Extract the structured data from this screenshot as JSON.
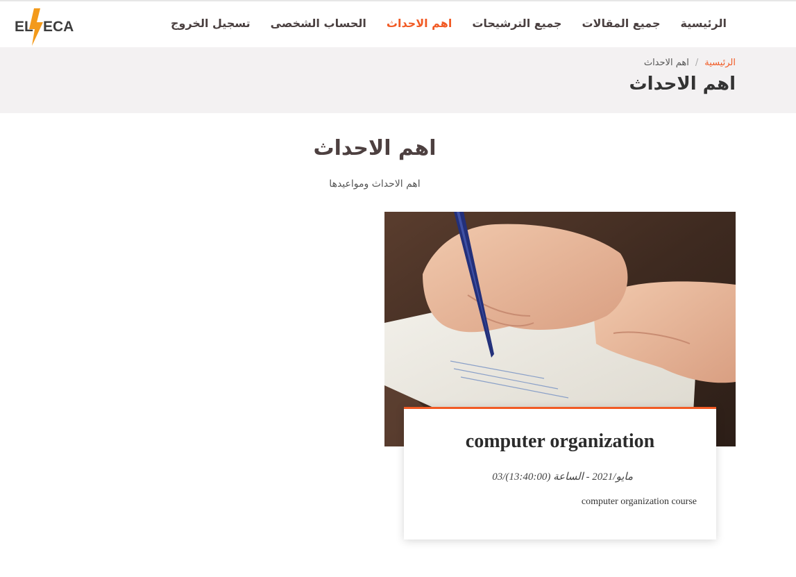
{
  "brand": {
    "logo_text": "ELSECA",
    "accent_color": "#f15a24"
  },
  "nav": {
    "items": [
      {
        "label": "الرئيسية",
        "active": false
      },
      {
        "label": "جميع المقالات",
        "active": false
      },
      {
        "label": "جميع الترشيحات",
        "active": false
      },
      {
        "label": "اهم الاحداث",
        "active": true
      },
      {
        "label": "الحساب الشخصى",
        "active": false
      },
      {
        "label": "تسجيل الخروج",
        "active": false
      }
    ]
  },
  "breadcrumb": {
    "home": "الرئيسية",
    "separator": "/",
    "current": "اهم الاحداث"
  },
  "page": {
    "title": "اهم الاحداث"
  },
  "section": {
    "title": "اهم الاحداث",
    "subtitle": "اهم الاحداث ومواعيدها"
  },
  "event": {
    "image_icon": "writing-photo",
    "title": "computer organization",
    "date": "03/مايو/2021 - الساعة (13:40:00)",
    "description": "computer organization course"
  }
}
